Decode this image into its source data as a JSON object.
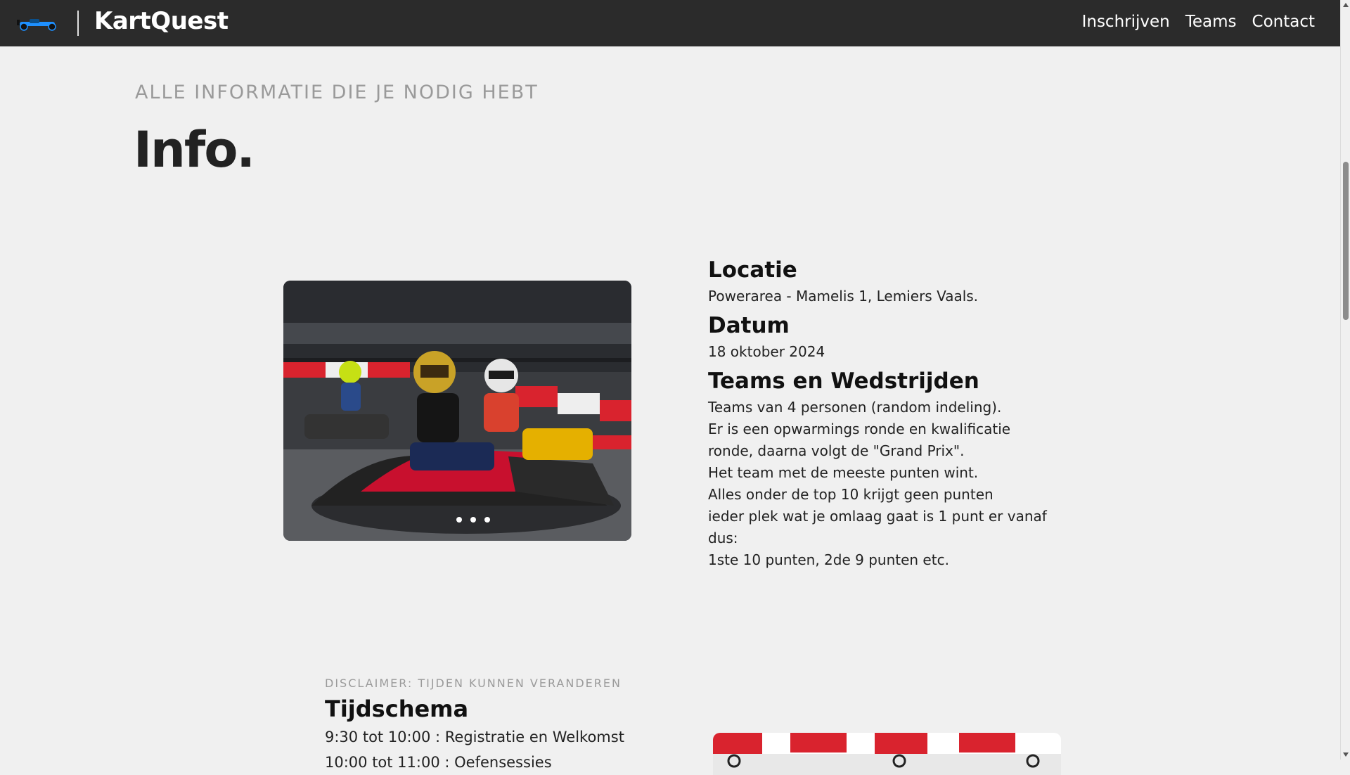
{
  "nav": {
    "brand": "KartQuest",
    "links": [
      "Inschrijven",
      "Teams",
      "Contact"
    ]
  },
  "hero": {
    "eyebrow": "ALLE INFORMATIE DIE JE NODIG HEBT",
    "title": "Info."
  },
  "info": {
    "location_heading": "Locatie",
    "location_text": "Powerarea - Mamelis 1, Lemiers Vaals.",
    "date_heading": "Datum",
    "date_text": "18 oktober 2024",
    "teams_heading": "Teams en Wedstrijden",
    "teams_lines": [
      "Teams van 4 personen (random indeling).",
      "Er is een opwarmings ronde en kwalificatie",
      "ronde, daarna volgt de \"Grand Prix\".",
      "Het team met de meeste punten wint.",
      "Alles onder de top 10 krijgt geen punten",
      "ieder plek wat je omlaag gaat is 1 punt er vanaf",
      "dus:",
      "1ste 10 punten, 2de 9 punten etc."
    ]
  },
  "schedule": {
    "disclaimer": "DISCLAIMER: TIJDEN KUNNEN VERANDEREN",
    "title": "Tijdschema",
    "items": [
      "9:30 tot 10:00 : Registratie en Welkomst",
      "10:00 tot 11:00 : Oefensessies"
    ]
  },
  "icons": {
    "logo": "go-kart-icon",
    "scroll_up": "scroll-up-arrow-icon",
    "scroll_down": "scroll-down-arrow-icon"
  },
  "colors": {
    "navbar": "#2b2b2b",
    "background": "#f0f0f0",
    "kart_accent": "#1e90ff",
    "track_red": "#d9232e"
  }
}
